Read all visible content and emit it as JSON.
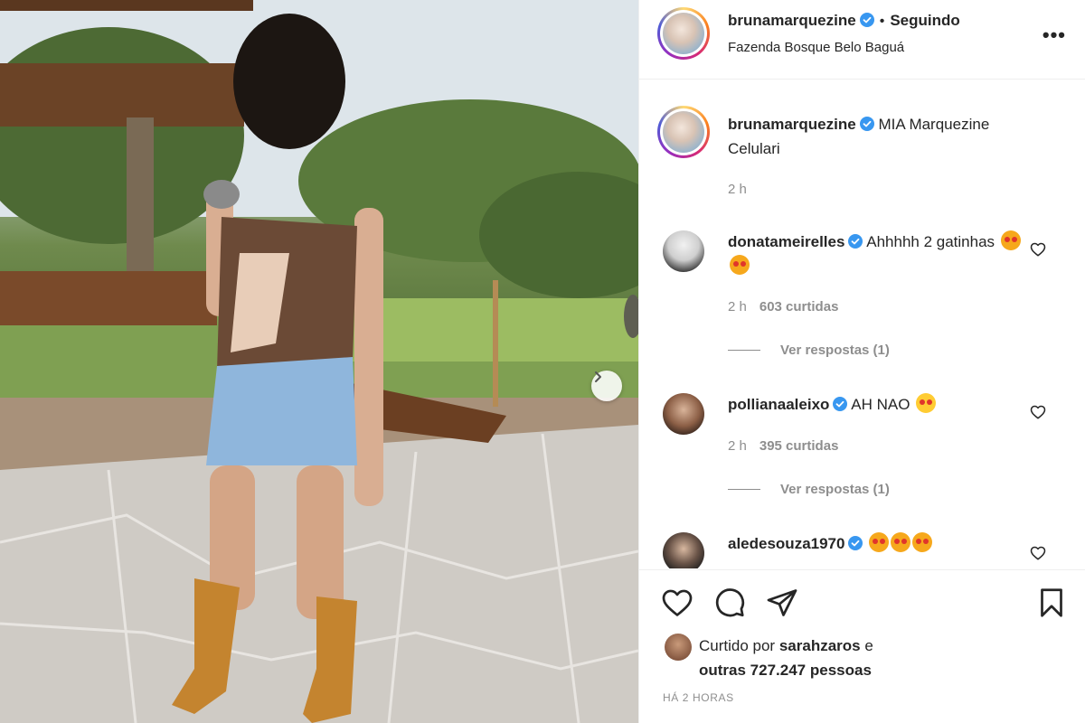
{
  "header": {
    "username": "brunamarquezine",
    "follow_status": "Seguindo",
    "location": "Fazenda Bosque Belo Baguá",
    "more_icon": "more-horizontal-icon"
  },
  "caption": {
    "username": "brunamarquezine",
    "text": "MIA Marquezine Celulari",
    "time": "2 h"
  },
  "comments": [
    {
      "username": "donatameirelles",
      "text": "Ahhhhh 2 gatinhas",
      "emojis": [
        "heart-eyes-cat",
        "heart-eyes-cat"
      ],
      "time": "2 h",
      "likes": "603 curtidas",
      "replies": "Ver respostas (1)"
    },
    {
      "username": "pollianaaleixo",
      "text": "AH NAO",
      "emojis": [
        "heart-eyes-face"
      ],
      "time": "2 h",
      "likes": "395 curtidas",
      "replies": "Ver respostas (1)"
    },
    {
      "username": "aledesouza1970",
      "text": "",
      "emojis": [
        "heart-eyes-cat",
        "heart-eyes-cat",
        "heart-eyes-cat"
      ]
    }
  ],
  "likes": {
    "prefix": "Curtido por",
    "user": "sarahzaros",
    "conjunction": "e",
    "others": "outras 727.247 pessoas"
  },
  "posted": "HÁ 2 HORAS",
  "icons": [
    "heart-icon",
    "comment-icon",
    "share-icon",
    "bookmark-icon",
    "verified-icon",
    "chevron-right-icon"
  ],
  "colors": {
    "verified": "#3897f0",
    "text": "#262626",
    "muted": "#8e8e8e",
    "border": "#efefef"
  }
}
